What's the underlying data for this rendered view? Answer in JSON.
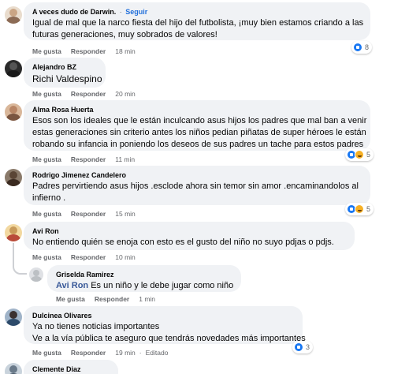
{
  "comments": [
    {
      "author": "A veces dudo de Darwin.",
      "follow_label": "Seguir",
      "lines": [
        "Igual de mal que la narco fiesta del hijo del futbolista, ¡muy bien estamos criando a las",
        "futuras generaciones, muy sobrados de valores!"
      ],
      "like_label": "Me gusta",
      "reply_label": "Responder",
      "time": "18 min",
      "reaction_count": "8",
      "avatar_color": "#d8bfa3"
    },
    {
      "author": "Alejandro BZ",
      "lines": [
        "Richi Valdespino"
      ],
      "like_label": "Me gusta",
      "reply_label": "Responder",
      "time": "20 min",
      "avatar_color": "#3a3a3a"
    },
    {
      "author": "Alma Rosa Huerta",
      "lines": [
        "Esos son los ideales que le están inculcando asus hijos los padres que mal ban a venir",
        "estas generaciones sin criterio antes los niños pedian piñatas de super héroes le están",
        "robando su infancia in poniendo los deseos de sus padres un tache para estos padres"
      ],
      "like_label": "Me gusta",
      "reply_label": "Responder",
      "time": "11 min",
      "reaction_count": "5",
      "avatar_color": "#c89a7a"
    },
    {
      "author": "Rodrigo Jimenez Candelero",
      "lines": [
        "Padres pervirtiendo asus hijos .esclode ahora sin temor sin amor .encaminandolos al",
        "infierno ."
      ],
      "like_label": "Me gusta",
      "reply_label": "Responder",
      "time": "15 min",
      "reaction_count": "5",
      "avatar_color": "#6b5a4a"
    },
    {
      "author": "Avi Ron",
      "lines": [
        "No entiendo quién se enoja con esto es el gusto del niño no suyo pdjas o pdjs."
      ],
      "like_label": "Me gusta",
      "reply_label": "Responder",
      "time": "10 min",
      "avatar_color": "#e6c07a"
    },
    {
      "author": "Griselda Ramirez",
      "mention": "Avi Ron",
      "lines": [
        "Es un niño y le debe jugar como niño"
      ],
      "like_label": "Me gusta",
      "reply_label": "Responder",
      "time": "1 min",
      "avatar_color": "#bcc0c4"
    },
    {
      "author": "Dulcinea Olivares",
      "lines": [
        "Ya no tienes noticias importantes",
        "Ve a la vía pública te aseguro que tendrás novedades más importantes"
      ],
      "like_label": "Me gusta",
      "reply_label": "Responder",
      "time": "19 min",
      "edited_label": "Editado",
      "reaction_count": "3",
      "avatar_color": "#4a6a8a"
    },
    {
      "author": "Clemente Diaz",
      "avatar_color": "#7a8a9a"
    }
  ]
}
